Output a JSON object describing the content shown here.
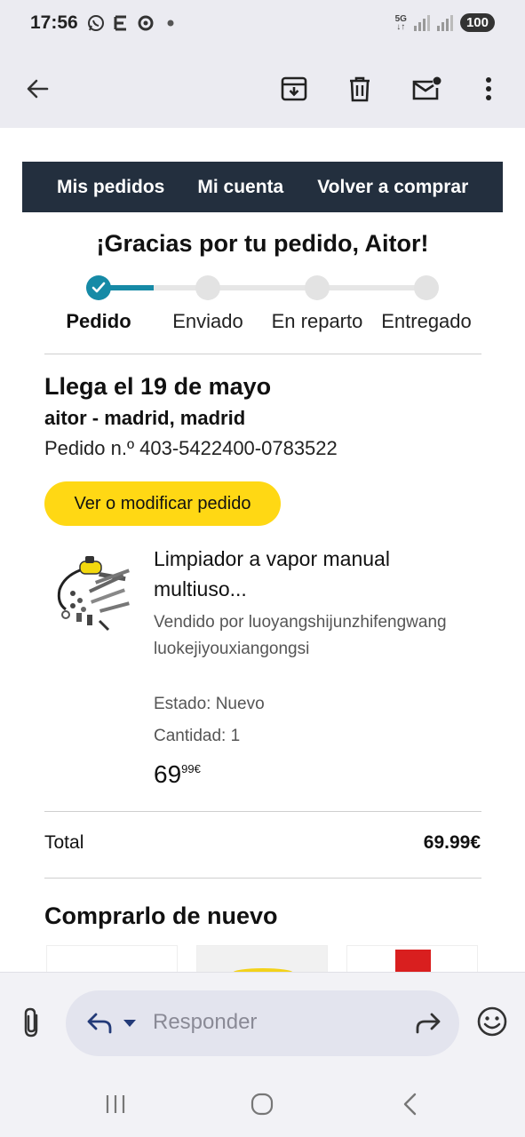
{
  "status_bar": {
    "time": "17:56",
    "left_icons": [
      "whatsapp-icon",
      "e-icon",
      "sync-icon",
      "dot-icon"
    ],
    "network": "5G",
    "battery": "100"
  },
  "app_bar": {
    "icons": [
      "back-arrow-icon",
      "archive-icon",
      "trash-icon",
      "mark-unread-icon",
      "more-vert-icon"
    ]
  },
  "email": {
    "nav": {
      "my_orders": "Mis pedidos",
      "my_account": "Mi cuenta",
      "buy_again": "Volver a comprar"
    },
    "thanks": "¡Gracias por tu pedido, Aitor!",
    "tracker": {
      "steps": [
        "Pedido",
        "Enviado",
        "En reparto",
        "Entregado"
      ],
      "current_step": 1
    },
    "arrival": "Llega el 19 de mayo",
    "address": "aitor - madrid, madrid",
    "order_number": "Pedido n.º 403-5422400-0783522",
    "view_button": "Ver o modificar pedido",
    "product": {
      "title": "Limpiador a vapor manual multiuso...",
      "seller": "Vendido por luoyangshijunzhifengwangluokejiyouxiangongsi",
      "state": "Estado: Nuevo",
      "quantity": "Cantidad: 1",
      "price_whole": "69",
      "price_fraction": "99€"
    },
    "total": {
      "label": "Total",
      "value": "69.99€"
    },
    "buy_again_title": "Comprarlo de nuevo"
  },
  "reply_bar": {
    "placeholder": "Responder"
  },
  "colors": {
    "nav_bg": "#232f3e",
    "button_yellow": "#ffd814",
    "tracker_teal": "#168aa6"
  }
}
